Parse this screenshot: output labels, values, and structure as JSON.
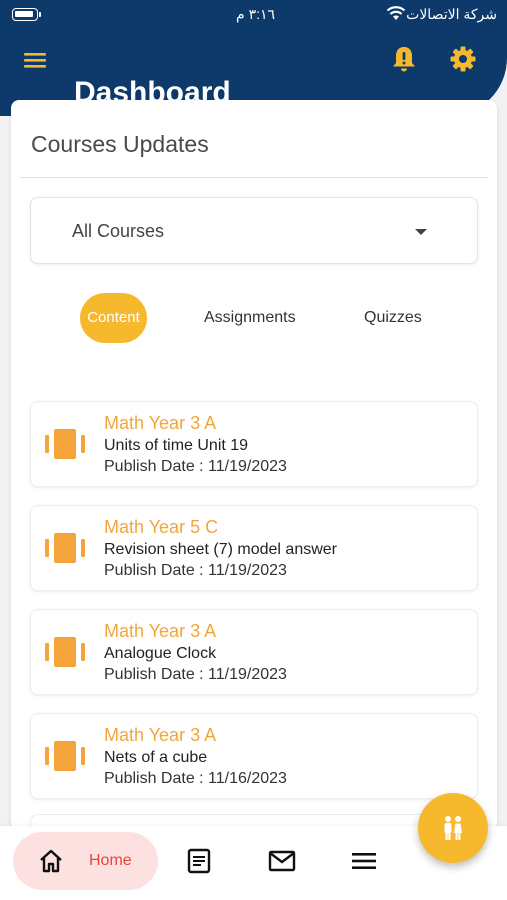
{
  "status_bar": {
    "carrier": "شركة الاتصالات",
    "time": "٣:١٦ م"
  },
  "header": {
    "title": "Dashboard",
    "icons": [
      "menu-icon",
      "bell-alert-icon",
      "gear-icon"
    ]
  },
  "section": {
    "title": "Courses Updates"
  },
  "course_filter": {
    "selected": "All Courses"
  },
  "tabs": [
    {
      "label": "Content",
      "active": true
    },
    {
      "label": "Assignments",
      "active": false
    },
    {
      "label": "Quizzes",
      "active": false
    }
  ],
  "updates": [
    {
      "course": "Math Year 3 A",
      "title": "Units of time Unit 19",
      "date": "Publish Date : 11/19/2023",
      "icon": "content-icon"
    },
    {
      "course": "Math Year 5 C",
      "title": "Revision sheet (7) model answer",
      "date": "Publish Date : 11/19/2023",
      "icon": "content-icon"
    },
    {
      "course": "Math Year 3 A",
      "title": "Analogue Clock",
      "date": "Publish Date : 11/19/2023",
      "icon": "content-icon"
    },
    {
      "course": "Math Year 3 A",
      "title": "Nets of a cube",
      "date": "Publish Date : 11/16/2023",
      "icon": "content-icon"
    }
  ],
  "bottom_nav": {
    "home_label": "Home",
    "icons": [
      "home-icon",
      "document-icon",
      "mail-icon",
      "menu-icon"
    ]
  },
  "fab": {
    "icon": "family-icon"
  },
  "colors": {
    "header_bg": "#0d3a6b",
    "accent": "#f6b92e",
    "course_text": "#f4a53a",
    "home_pill": "#fde1e1",
    "home_text": "#e8423b"
  }
}
